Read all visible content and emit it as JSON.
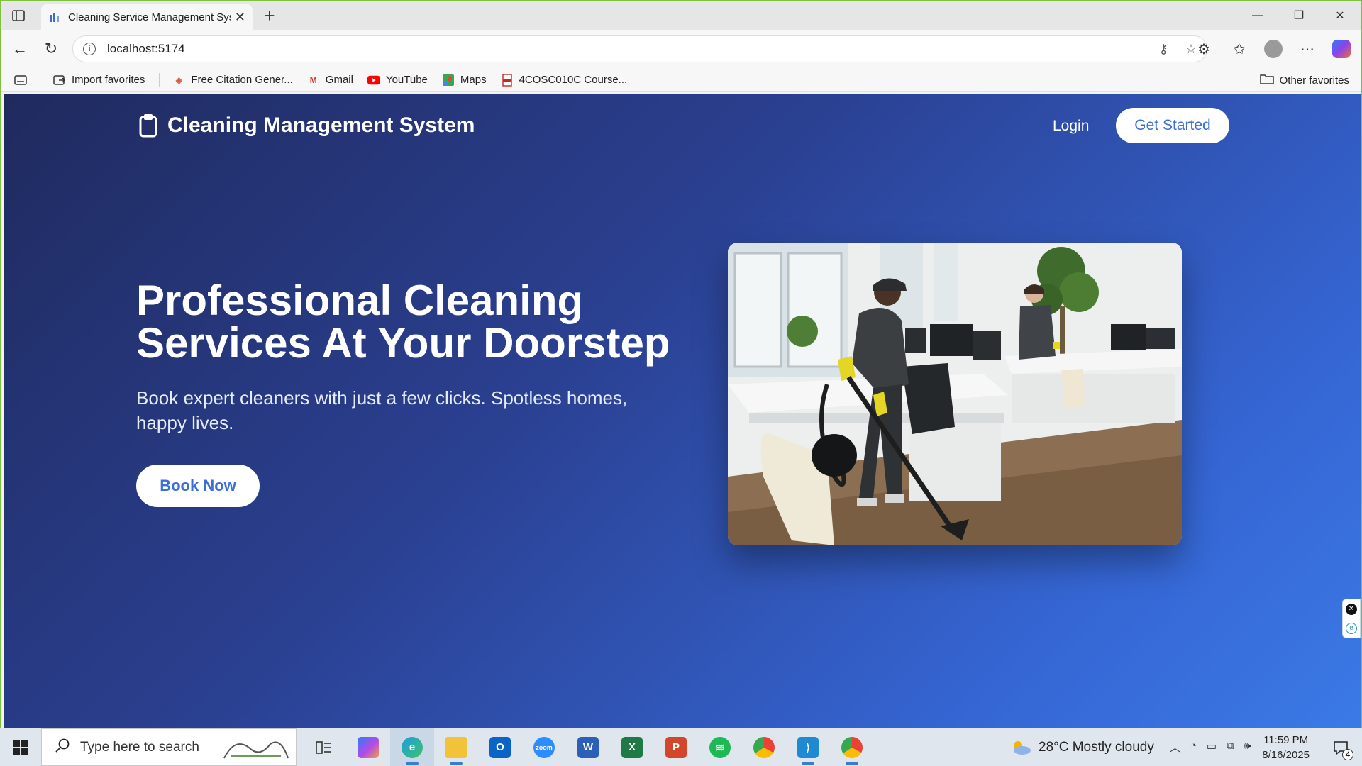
{
  "browser": {
    "tab_title": "Cleaning Service Management System",
    "url": "localhost:5174",
    "bookmarks": [
      {
        "label": "Import favorites"
      },
      {
        "label": "Free Citation Gener..."
      },
      {
        "label": "Gmail"
      },
      {
        "label": "YouTube"
      },
      {
        "label": "Maps"
      },
      {
        "label": "4COSC010C Course..."
      }
    ],
    "other_favorites": "Other favorites"
  },
  "page": {
    "brand": "Cleaning Management System",
    "nav": {
      "login": "Login",
      "get_started": "Get Started"
    },
    "hero": {
      "title_line1": "Professional Cleaning",
      "title_line2": "Services At Your Doorstep",
      "subtitle": "Book expert cleaners with just a few clicks. Spotless homes, happy lives.",
      "cta": "Book Now"
    },
    "colors": {
      "accent": "#3b6fd8",
      "gradient_start": "#1f2a5e",
      "gradient_end": "#3b7ae6"
    }
  },
  "taskbar": {
    "search_placeholder": "Type here to search",
    "weather": "28°C  Mostly cloudy",
    "time": "11:59 PM",
    "date": "8/16/2025",
    "notification_count": "4"
  }
}
